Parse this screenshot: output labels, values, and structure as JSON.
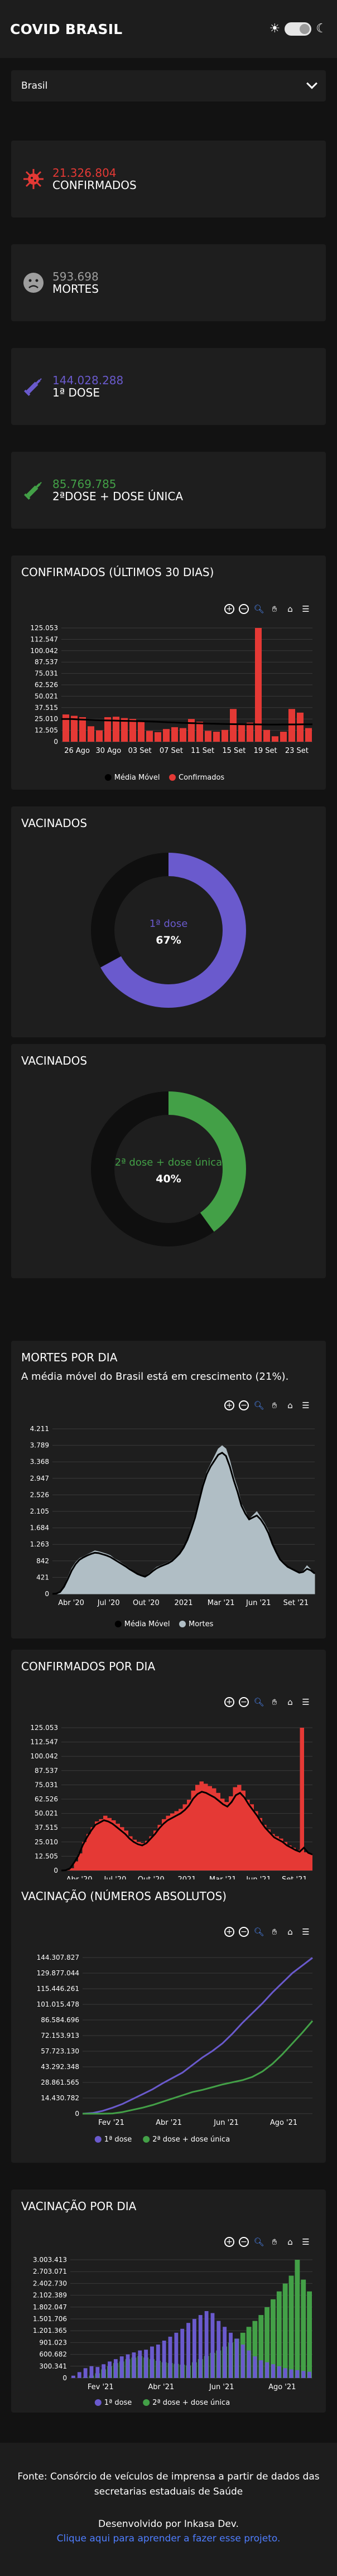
{
  "header": {
    "title": "COVID BRASIL",
    "sun_icon": "☀",
    "moon_icon": "☾"
  },
  "location_select": {
    "value": "Brasil"
  },
  "stats": [
    {
      "value": "21.326.804",
      "label": "CONFIRMADOS",
      "color": "#e53935"
    },
    {
      "value": "593.698",
      "label": "MORTES",
      "color": "#9e9e9e"
    },
    {
      "value": "144.028.288",
      "label": "1ª DOSE",
      "color": "#6a5acd"
    },
    {
      "value": "85.769.785",
      "label": "2ªDOSE + DOSE ÚNICA",
      "color": "#43a047"
    }
  ],
  "charts": {
    "confirm30": {
      "title": "CONFIRMADOS (ÚLTIMOS 30 DIAS)"
    },
    "vac1": {
      "title": "VACINADOS",
      "center_label": "1ª dose",
      "center_value": "67%",
      "percent": 67,
      "color": "#6a5acd"
    },
    "vac2": {
      "title": "VACINADOS",
      "center_label": "2ª dose + dose única",
      "center_value": "40%",
      "percent": 40,
      "color": "#43a047"
    },
    "deaths": {
      "title": "MORTES POR DIA",
      "subtitle": "A média móvel do Brasil está em crescimento (21%)."
    },
    "confirmDay": {
      "title": "CONFIRMADOS POR DIA"
    },
    "vacAbs": {
      "title": "VACINAÇÃO (NÚMEROS ABSOLUTOS)"
    },
    "vacDay": {
      "title": "VACINAÇÃO POR DIA"
    }
  },
  "legends": {
    "media_movel": "Média Móvel",
    "confirmados": "Confirmados",
    "mortes": "Mortes",
    "dose1": "1ª dose",
    "dose2": "2ª dose + dose única"
  },
  "footer": {
    "source_line1": "Fonte: Consórcio de veículos de imprensa a partir de dados das",
    "source_line2": "secretarias estaduais de Saúde",
    "dev": "Desenvolvido por Inkasa Dev.",
    "link": "Clique aqui para aprender a fazer esse projeto."
  },
  "chart_data": [
    {
      "id": "confirm30",
      "type": "bar",
      "categories": [
        "26 Ago",
        "27 Ago",
        "28 Ago",
        "29 Ago",
        "30 Ago",
        "31 Ago",
        "01 Set",
        "02 Set",
        "03 Set",
        "04 Set",
        "05 Set",
        "06 Set",
        "07 Set",
        "08 Set",
        "09 Set",
        "10 Set",
        "11 Set",
        "12 Set",
        "13 Set",
        "14 Set",
        "15 Set",
        "16 Set",
        "17 Set",
        "18 Set",
        "19 Set",
        "20 Set",
        "21 Set",
        "22 Set",
        "23 Set",
        "24 Set"
      ],
      "x_tick_labels": [
        "26 Ago",
        "30 Ago",
        "03 Set",
        "07 Set",
        "11 Set",
        "15 Set",
        "19 Set",
        "23 Set"
      ],
      "series": [
        {
          "name": "Confirmados",
          "values": [
            30000,
            28500,
            27000,
            17000,
            12500,
            27000,
            27500,
            26000,
            25000,
            22000,
            12000,
            10500,
            14000,
            16000,
            15000,
            25000,
            22000,
            12000,
            11000,
            13000,
            36000,
            18500,
            21000,
            125053,
            13000,
            6000,
            11000,
            36000,
            32000,
            15000
          ]
        },
        {
          "name": "Média Móvel",
          "values": [
            25000,
            25000,
            24500,
            24200,
            23800,
            23500,
            23300,
            23000,
            22800,
            22600,
            22300,
            22000,
            21500,
            21200,
            20800,
            20500,
            20200,
            19900,
            19700,
            19500,
            19300,
            19200,
            19100,
            19000,
            18900,
            18900,
            19000,
            19000,
            19100,
            19200
          ]
        }
      ],
      "y_ticks": [
        "125.053",
        "112.547",
        "100.042",
        "87.537",
        "75.031",
        "62.526",
        "50.021",
        "37.515",
        "25.010",
        "12.505",
        "0"
      ],
      "ylim": [
        0,
        125053
      ]
    },
    {
      "id": "deaths",
      "type": "area",
      "x_tick_labels": [
        "Abr '20",
        "Jul '20",
        "Out '20",
        "2021",
        "Mar '21",
        "Jun '21",
        "Set '21"
      ],
      "y_ticks": [
        "4.211",
        "3.789",
        "3.368",
        "2.947",
        "2.526",
        "2.105",
        "1.684",
        "1.263",
        "842",
        "421",
        "0"
      ],
      "ylim": [
        0,
        4211
      ],
      "series": [
        {
          "name": "Mortes",
          "values": [
            0,
            10,
            60,
            200,
            420,
            650,
            800,
            900,
            950,
            1000,
            1050,
            1100,
            1080,
            1050,
            1020,
            980,
            900,
            850,
            780,
            720,
            650,
            580,
            520,
            480,
            450,
            520,
            600,
            680,
            720,
            760,
            800,
            860,
            950,
            1050,
            1200,
            1400,
            1700,
            2000,
            2400,
            2800,
            3100,
            3300,
            3500,
            3700,
            3780,
            3700,
            3400,
            3000,
            2700,
            2300,
            2100,
            1900,
            2000,
            2100,
            1950,
            1800,
            1600,
            1300,
            1100,
            900,
            800,
            700,
            650,
            600,
            550,
            580,
            720,
            620,
            500
          ]
        },
        {
          "name": "Média Móvel",
          "values": [
            0,
            8,
            50,
            180,
            380,
            600,
            760,
            870,
            930,
            980,
            1020,
            1050,
            1040,
            1010,
            980,
            940,
            880,
            820,
            760,
            700,
            630,
            570,
            510,
            470,
            440,
            500,
            580,
            650,
            700,
            740,
            780,
            840,
            930,
            1030,
            1180,
            1380,
            1650,
            1950,
            2350,
            2750,
            3050,
            3250,
            3400,
            3550,
            3600,
            3520,
            3250,
            2900,
            2600,
            2250,
            2050,
            1900,
            1950,
            2000,
            1900,
            1750,
            1550,
            1280,
            1070,
            880,
            780,
            690,
            640,
            590,
            540,
            560,
            640,
            600,
            520
          ]
        }
      ]
    },
    {
      "id": "confirmDay",
      "type": "bar",
      "x_tick_labels": [
        "Abr '20",
        "Jul '20",
        "Out '20",
        "2021",
        "Mar '21",
        "Jun '21",
        "Set '21"
      ],
      "y_ticks": [
        "125.053",
        "112.547",
        "100.042",
        "87.537",
        "75.031",
        "62.526",
        "50.021",
        "37.515",
        "25.010",
        "12.505",
        "0"
      ],
      "ylim": [
        0,
        125053
      ],
      "series": [
        {
          "name": "Confirmados",
          "values": [
            0,
            300,
            2000,
            8000,
            15000,
            25000,
            32000,
            38000,
            43000,
            45000,
            48000,
            46000,
            44000,
            41000,
            38000,
            35000,
            30000,
            27000,
            25000,
            24000,
            26000,
            30000,
            35000,
            40000,
            45000,
            48000,
            50000,
            52000,
            54000,
            58000,
            62000,
            70000,
            75000,
            78000,
            76000,
            74000,
            72000,
            68000,
            63000,
            60000,
            65000,
            73000,
            75000,
            70000,
            62000,
            58000,
            52000,
            46000,
            40000,
            36000,
            32000,
            30000,
            28000,
            25000,
            22000,
            20000,
            18000,
            125053,
            16000,
            15000
          ]
        },
        {
          "name": "Média Móvel",
          "values": [
            0,
            250,
            1800,
            7000,
            13000,
            22000,
            29000,
            35000,
            40000,
            42000,
            44000,
            43000,
            41000,
            38000,
            35000,
            32000,
            28000,
            25000,
            23000,
            22000,
            24000,
            28000,
            32000,
            37000,
            41000,
            44000,
            46000,
            48000,
            50000,
            53000,
            57000,
            63000,
            67000,
            69000,
            68000,
            66000,
            64000,
            61000,
            58000,
            56000,
            60000,
            66000,
            68000,
            64000,
            58000,
            53000,
            48000,
            42000,
            37000,
            33000,
            29000,
            27000,
            25000,
            22000,
            20000,
            18000,
            16500,
            20000,
            15500,
            14000
          ]
        }
      ]
    },
    {
      "id": "vacAbs",
      "type": "line",
      "x_tick_labels": [
        "Fev '21",
        "Abr '21",
        "Jun '21",
        "Ago '21"
      ],
      "y_ticks": [
        "144.307.827",
        "129.877.044",
        "115.446.261",
        "101.015.478",
        "86.584.696",
        "72.153.913",
        "57.723.130",
        "43.292.348",
        "28.861.565",
        "14.430.782",
        "0"
      ],
      "ylim": [
        0,
        144307827
      ],
      "series": [
        {
          "name": "1ª dose",
          "values": [
            0,
            600000,
            2500000,
            5500000,
            9000000,
            13500000,
            18000000,
            22500000,
            28000000,
            33000000,
            38000000,
            45000000,
            52000000,
            58000000,
            65000000,
            74000000,
            84000000,
            93000000,
            102000000,
            112000000,
            121000000,
            130000000,
            137000000,
            144028288
          ]
        },
        {
          "name": "2ª dose + dose única",
          "values": [
            0,
            0,
            0,
            200000,
            1500000,
            3500000,
            5500000,
            8000000,
            11000000,
            14000000,
            17000000,
            20000000,
            22000000,
            24500000,
            27000000,
            29000000,
            31000000,
            34000000,
            39000000,
            46000000,
            55000000,
            65000000,
            75000000,
            85769785
          ]
        }
      ]
    },
    {
      "id": "vacDay",
      "type": "bar",
      "x_tick_labels": [
        "Fev '21",
        "Abr '21",
        "Jun '21",
        "Ago '21"
      ],
      "y_ticks": [
        "3.003.413",
        "2.703.071",
        "2.402.730",
        "2.102.389",
        "1.802.047",
        "1.501.706",
        "1.201.365",
        "901.023",
        "600.682",
        "300.341",
        "0"
      ],
      "ylim": [
        0,
        3003413
      ],
      "series": [
        {
          "name": "1ª dose",
          "values": [
            60000,
            150000,
            250000,
            300000,
            280000,
            350000,
            420000,
            480000,
            550000,
            600000,
            650000,
            700000,
            720000,
            800000,
            850000,
            950000,
            1050000,
            1150000,
            1250000,
            1400000,
            1500000,
            1600000,
            1700000,
            1650000,
            1450000,
            1300000,
            1150000,
            1000000,
            850000,
            700000,
            550000,
            450000,
            400000,
            350000,
            300000,
            250000,
            220000,
            200000,
            180000,
            160000
          ]
        },
        {
          "name": "2ª dose + dose única",
          "values": [
            0,
            0,
            20000,
            60000,
            120000,
            220000,
            300000,
            380000,
            420000,
            480000,
            520000,
            560000,
            520000,
            480000,
            440000,
            400000,
            380000,
            360000,
            340000,
            320000,
            400000,
            480000,
            560000,
            640000,
            700000,
            800000,
            900000,
            1000000,
            1150000,
            1300000,
            1450000,
            1600000,
            1800000,
            2000000,
            2200000,
            2400000,
            2600000,
            3003413,
            2500000,
            2200000
          ]
        }
      ]
    },
    {
      "id": "vac1",
      "type": "pie",
      "categories": [
        "1ª dose",
        "restante"
      ],
      "values": [
        67,
        33
      ]
    },
    {
      "id": "vac2",
      "type": "pie",
      "categories": [
        "2ª dose + dose única",
        "restante"
      ],
      "values": [
        40,
        60
      ]
    }
  ]
}
